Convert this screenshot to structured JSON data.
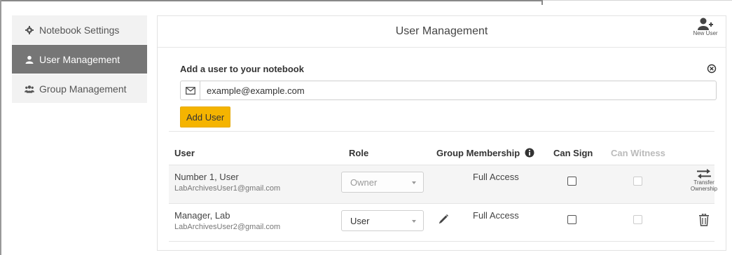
{
  "sidebar": {
    "items": [
      {
        "label": "Notebook Settings",
        "icon": "gear-icon",
        "active": false
      },
      {
        "label": "User Management",
        "icon": "user-icon",
        "active": true
      },
      {
        "label": "Group Management",
        "icon": "users-icon",
        "active": false
      }
    ]
  },
  "header": {
    "title": "User Management",
    "new_user_label": "New User"
  },
  "add_user": {
    "title": "Add a user to your notebook",
    "email_value": "example@example.com",
    "button_label": "Add User"
  },
  "table": {
    "columns": {
      "user": "User",
      "role": "Role",
      "group": "Group Membership",
      "can_sign": "Can Sign",
      "can_witness": "Can Witness"
    },
    "rows": [
      {
        "name": "Number 1, User",
        "email": "LabArchivesUser1@gmail.com",
        "role": "Owner",
        "group": "Full Access",
        "action_line1": "Transfer",
        "action_line2": "Ownership"
      },
      {
        "name": "Manager, Lab",
        "email": "LabArchivesUser2@gmail.com",
        "role": "User",
        "group": "Full Access"
      }
    ]
  },
  "colors": {
    "accent_button": "#f5b400",
    "sidebar_active": "#767676",
    "sidebar_bg": "#f2f2f2"
  }
}
